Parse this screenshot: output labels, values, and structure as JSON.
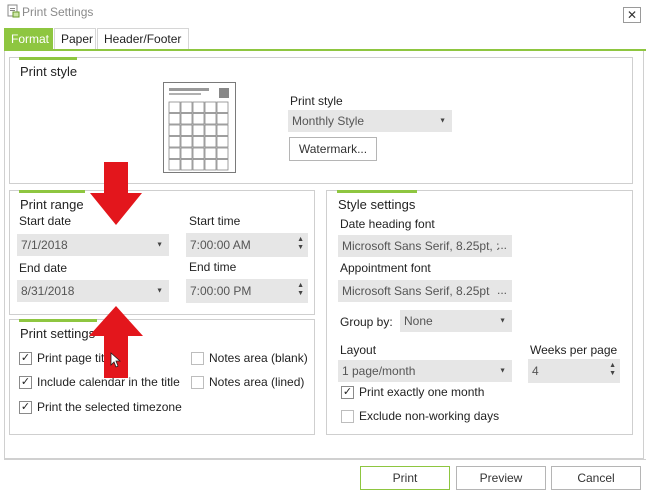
{
  "window": {
    "title": "Print Settings",
    "close": "✕"
  },
  "tabs": [
    {
      "label": "Format",
      "active": true
    },
    {
      "label": "Paper",
      "active": false
    },
    {
      "label": "Header/Footer",
      "active": false
    }
  ],
  "print_style": {
    "title": "Print style",
    "label": "Print style",
    "value": "Monthly Style",
    "watermark_button": "Watermark..."
  },
  "print_range": {
    "title": "Print range",
    "start_date_label": "Start date",
    "start_date": "7/1/2018",
    "end_date_label": "End date",
    "end_date": "8/31/2018",
    "start_time_label": "Start time",
    "start_time": "7:00:00 AM",
    "end_time_label": "End time",
    "end_time": "7:00:00 PM"
  },
  "print_settings": {
    "title": "Print settings",
    "options": [
      {
        "label": "Print page title",
        "checked": true
      },
      {
        "label": "Include calendar in the title",
        "checked": true
      },
      {
        "label": "Print the selected timezone",
        "checked": true
      },
      {
        "label": "Notes area (blank)",
        "checked": false
      },
      {
        "label": "Notes area (lined)",
        "checked": false
      }
    ]
  },
  "style_settings": {
    "title": "Style settings",
    "date_heading_font_label": "Date heading font",
    "date_heading_font": "Microsoft Sans Serif, 8.25pt, :",
    "appointment_font_label": "Appointment font",
    "appointment_font": "Microsoft Sans Serif, 8.25pt",
    "font_button": "...",
    "group_by_label": "Group by:",
    "group_by": "None",
    "layout_label": "Layout",
    "layout": "1 page/month",
    "weeks_per_page_label": "Weeks per page",
    "weeks_per_page": "4",
    "print_exactly_one_month": {
      "label": "Print exactly one month",
      "checked": true
    },
    "exclude_non_working_days": {
      "label": "Exclude non-working days",
      "checked": false
    }
  },
  "footer": {
    "print": "Print",
    "preview": "Preview",
    "cancel": "Cancel"
  },
  "colors": {
    "accent": "#8ec640",
    "annotation_arrow": "#e3161c"
  },
  "glyphs": {
    "check": "✓",
    "caret": "▼",
    "up": "▲",
    "down": "▼"
  }
}
